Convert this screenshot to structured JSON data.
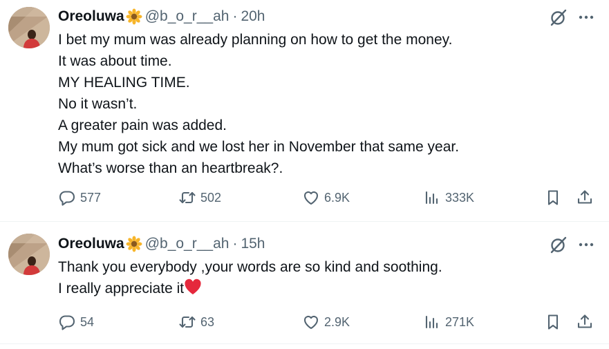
{
  "tweets": [
    {
      "author": {
        "name": "Oreoluwa",
        "handle": "@b_o_r__ah",
        "badge_icon": "sunflower-emoji"
      },
      "time": "20h",
      "text_lines": [
        "I bet my mum was already planning on how to get the money.",
        "It was about time.",
        "MY HEALING TIME.",
        "No it wasn’t.",
        "A greater pain was added.",
        "My mum got sick and we lost her in November that same year.",
        "What’s worse than an heartbreak?."
      ],
      "stats": {
        "replies": "577",
        "reposts": "502",
        "likes": "6.9K",
        "views": "333K"
      }
    },
    {
      "author": {
        "name": "Oreoluwa",
        "handle": "@b_o_r__ah",
        "badge_icon": "sunflower-emoji"
      },
      "time": "15h",
      "text_lines": [
        "Thank you everybody ,your words are so kind and soothing.",
        "I really appreciate it"
      ],
      "trailing_emoji": "red-heart-emoji",
      "stats": {
        "replies": "54",
        "reposts": "63",
        "likes": "2.9K",
        "views": "271K"
      }
    }
  ],
  "separator": "·",
  "colors": {
    "text": "#0f1419",
    "secondary": "#536471",
    "divider": "#eff3f4",
    "heart": "#e5283c",
    "sunflower": "#f7b52a"
  }
}
